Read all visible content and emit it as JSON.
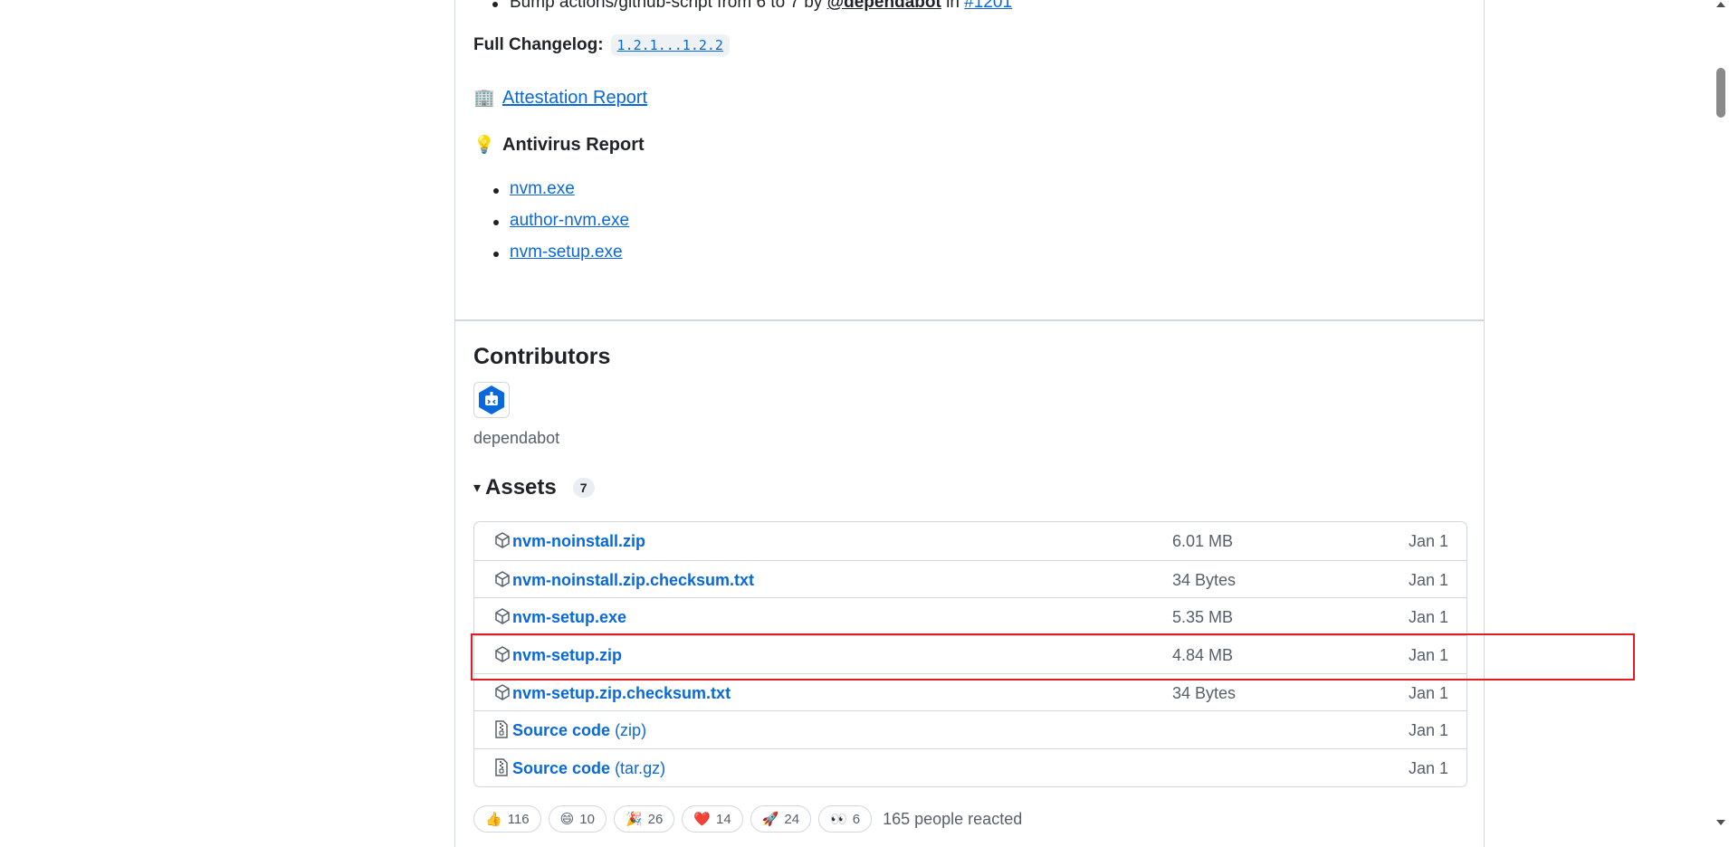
{
  "release_notes": {
    "bullet_prefix": "Bump actions/github-script from 6 to 7 by",
    "bullet_mention": "@dependabot",
    "bullet_in": "in",
    "bullet_issue": "#1201",
    "changelog_label": "Full Changelog:",
    "changelog_link": "1.2.1...1.2.2",
    "attestation_emoji": "🏢",
    "attestation_link": "Attestation Report",
    "antivirus_emoji": "💡",
    "antivirus_title": "Antivirus Report",
    "antivirus_links": [
      "nvm.exe",
      "author-nvm.exe",
      "nvm-setup.exe"
    ]
  },
  "contributors": {
    "title": "Contributors",
    "items": [
      {
        "name": "dependabot",
        "avatar": "dependabot-bot-icon"
      }
    ]
  },
  "assets": {
    "toggle": "▾",
    "title": "Assets",
    "count": "7",
    "rows": [
      {
        "name": "nvm-noinstall.zip",
        "suffix": "",
        "size": "6.01 MB",
        "date": "Jan 1",
        "icon": "package-icon"
      },
      {
        "name": "nvm-noinstall.zip.checksum.txt",
        "suffix": "",
        "size": "34 Bytes",
        "date": "Jan 1",
        "icon": "package-icon"
      },
      {
        "name": "nvm-setup.exe",
        "suffix": "",
        "size": "5.35 MB",
        "date": "Jan 1",
        "icon": "package-icon"
      },
      {
        "name": "nvm-setup.zip",
        "suffix": "",
        "size": "4.84 MB",
        "date": "Jan 1",
        "icon": "package-icon"
      },
      {
        "name": "nvm-setup.zip.checksum.txt",
        "suffix": "",
        "size": "34 Bytes",
        "date": "Jan 1",
        "icon": "package-icon"
      },
      {
        "name": "Source code",
        "suffix": "(zip)",
        "size": "",
        "date": "Jan 1",
        "icon": "file-zip-icon"
      },
      {
        "name": "Source code",
        "suffix": "(tar.gz)",
        "size": "",
        "date": "Jan 1",
        "icon": "file-zip-icon"
      }
    ]
  },
  "reactions": {
    "items": [
      {
        "emoji": "👍",
        "count": "116"
      },
      {
        "emoji": "😄",
        "count": "10"
      },
      {
        "emoji": "🎉",
        "count": "26"
      },
      {
        "emoji": "❤️",
        "count": "14"
      },
      {
        "emoji": "🚀",
        "count": "24"
      },
      {
        "emoji": "👀",
        "count": "6"
      }
    ],
    "summary": "165 people reacted"
  },
  "colors": {
    "link": "#0969da",
    "highlight": "#e01c24",
    "border": "#d0d7de",
    "muted": "#57606a"
  }
}
